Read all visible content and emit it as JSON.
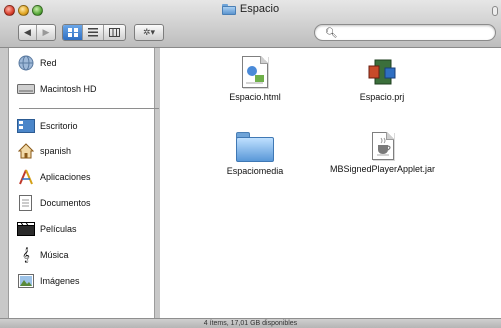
{
  "window": {
    "title": "Espacio"
  },
  "toolbar": {
    "back_forward": [
      "◀",
      "▶"
    ],
    "view_buttons": [
      "icon-view",
      "list-view",
      "column-view"
    ],
    "action_label": "✲▾",
    "search_placeholder": ""
  },
  "sidebar": {
    "items": [
      {
        "label": "Red",
        "icon": "globe-icon"
      },
      {
        "label": "Macintosh HD",
        "icon": "hard-drive-icon"
      },
      {
        "label": "Escritorio",
        "icon": "desktop-icon"
      },
      {
        "label": "spanish",
        "icon": "home-icon"
      },
      {
        "label": "Aplicaciones",
        "icon": "applications-icon"
      },
      {
        "label": "Documentos",
        "icon": "documents-icon"
      },
      {
        "label": "Películas",
        "icon": "movies-icon"
      },
      {
        "label": "Música",
        "icon": "music-icon"
      },
      {
        "label": "Imágenes",
        "icon": "pictures-icon"
      }
    ]
  },
  "files": [
    {
      "label": "Espacio.html",
      "icon": "html-document-icon"
    },
    {
      "label": "Espacio.prj",
      "icon": "project-file-icon"
    },
    {
      "label": "Espaciomedia",
      "icon": "folder-icon"
    },
    {
      "label": "MBSignedPlayerApplet.jar",
      "icon": "jar-file-icon"
    }
  ],
  "status": {
    "text": "4 ítems, 17,01 GB disponibles"
  },
  "colors": {
    "selected_view": "#2f6fc2",
    "folder": "#5a98d8"
  }
}
